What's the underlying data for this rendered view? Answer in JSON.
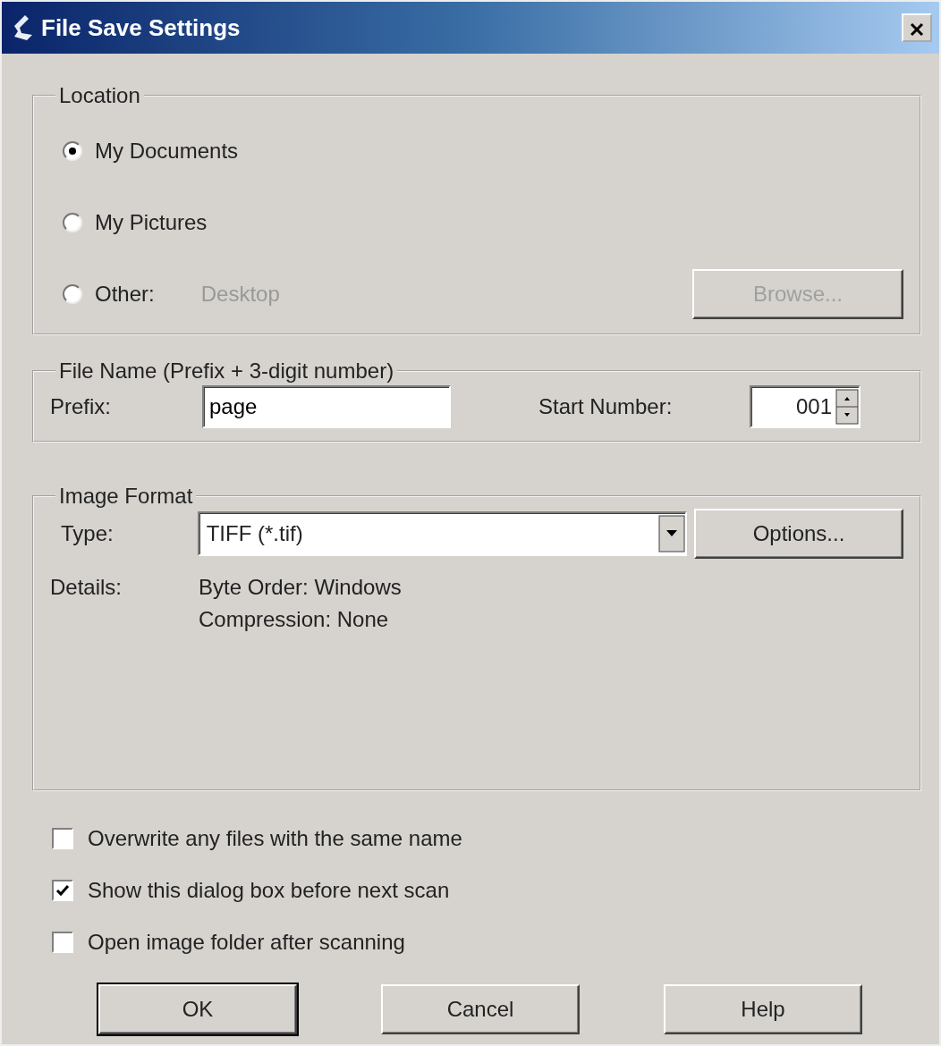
{
  "window": {
    "title": "File Save Settings"
  },
  "location": {
    "legend": "Location",
    "options": [
      {
        "label": "My Documents",
        "selected": true
      },
      {
        "label": "My Pictures",
        "selected": false
      },
      {
        "label": "Other:",
        "selected": false,
        "path": "Desktop",
        "path_disabled": true
      }
    ],
    "browse_button": {
      "label": "Browse...",
      "disabled": true
    }
  },
  "file_name": {
    "legend": "File Name (Prefix + 3-digit number)",
    "prefix_label": "Prefix:",
    "prefix_value": "page",
    "start_label": "Start Number:",
    "start_value": "001"
  },
  "image_format": {
    "legend": "Image Format",
    "type_label": "Type:",
    "type_value": "TIFF (*.tif)",
    "options_button": "Options...",
    "details_label": "Details:",
    "details": [
      "Byte Order: Windows",
      "Compression: None"
    ]
  },
  "checkboxes": [
    {
      "label": "Overwrite any files with the same name",
      "checked": false
    },
    {
      "label": "Show this dialog box before next scan",
      "checked": true
    },
    {
      "label": "Open image folder after scanning",
      "checked": false
    }
  ],
  "buttons": [
    {
      "label": "OK",
      "default": true
    },
    {
      "label": "Cancel",
      "default": false
    },
    {
      "label": "Help",
      "default": false
    }
  ]
}
